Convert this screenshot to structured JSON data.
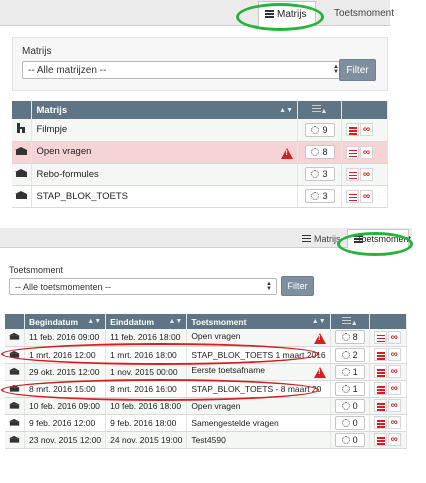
{
  "matrix_panel": {
    "tabs": {
      "active": "Matrijs",
      "other": "Toetsmoment"
    },
    "filter": {
      "label": "Matrijs",
      "select_value": "-- Alle matrijzen --",
      "button": "Filter"
    },
    "columns": {
      "name": "Matrijs"
    },
    "rows": [
      {
        "type_icon": "flow-icon",
        "name": "Filmpje",
        "warning": false,
        "count": "9"
      },
      {
        "type_icon": "cap-icon",
        "name": "Open vragen",
        "warning": true,
        "count": "8"
      },
      {
        "type_icon": "cap-icon",
        "name": "Rebo-formules",
        "warning": false,
        "count": "3"
      },
      {
        "type_icon": "cap-icon",
        "name": "STAP_BLOK_TOETS",
        "warning": false,
        "count": "3"
      }
    ]
  },
  "moment_panel": {
    "tabs": {
      "matrix": "Matrijs",
      "active": "Toetsmoment"
    },
    "filter": {
      "label": "Toetsmoment",
      "select_value": "-- Alle toetsmomenten --",
      "button": "Filter"
    },
    "columns": {
      "start": "Begindatum",
      "end": "Einddatum",
      "moment": "Toetsmoment"
    },
    "rows": [
      {
        "start": "11 feb. 2016 09:00",
        "end": "11 feb. 2016 18:00",
        "moment": "Open vragen",
        "warning": true,
        "count": "8"
      },
      {
        "start": "1 mrt. 2016 12:00",
        "end": "1 mrt. 2016 18:00",
        "moment": "STAP_BLOK_TOETS 1 maart 2016",
        "warning": false,
        "count": "2"
      },
      {
        "start": "29 okt. 2015 12:00",
        "end": "1 nov. 2015 00:00",
        "moment": "Eerste toetsafname",
        "warning": true,
        "count": "1"
      },
      {
        "start": "8 mrt. 2016 15:00",
        "end": "8 mrt. 2016 16:00",
        "moment": "STAP_BLOK_TOETS - 8 maart 20",
        "warning": false,
        "count": "1"
      },
      {
        "start": "10 feb. 2016 09:00",
        "end": "10 feb. 2016 18:00",
        "moment": "Open vragen",
        "warning": false,
        "count": "0"
      },
      {
        "start": "9 feb. 2016 12:00",
        "end": "9 feb. 2016 18:00",
        "moment": "Samengestelde vragen",
        "warning": false,
        "count": "0"
      },
      {
        "start": "23 nov. 2015 12:00",
        "end": "24 nov. 2015 19:00",
        "moment": "Test4590",
        "warning": false,
        "count": "0"
      }
    ]
  },
  "colors": {
    "header": "#5f7585",
    "warning_row": "#f6d3d5",
    "highlight_green": "#27b23c",
    "highlight_red": "#d42020",
    "filter_button": "#7f8f9f"
  }
}
